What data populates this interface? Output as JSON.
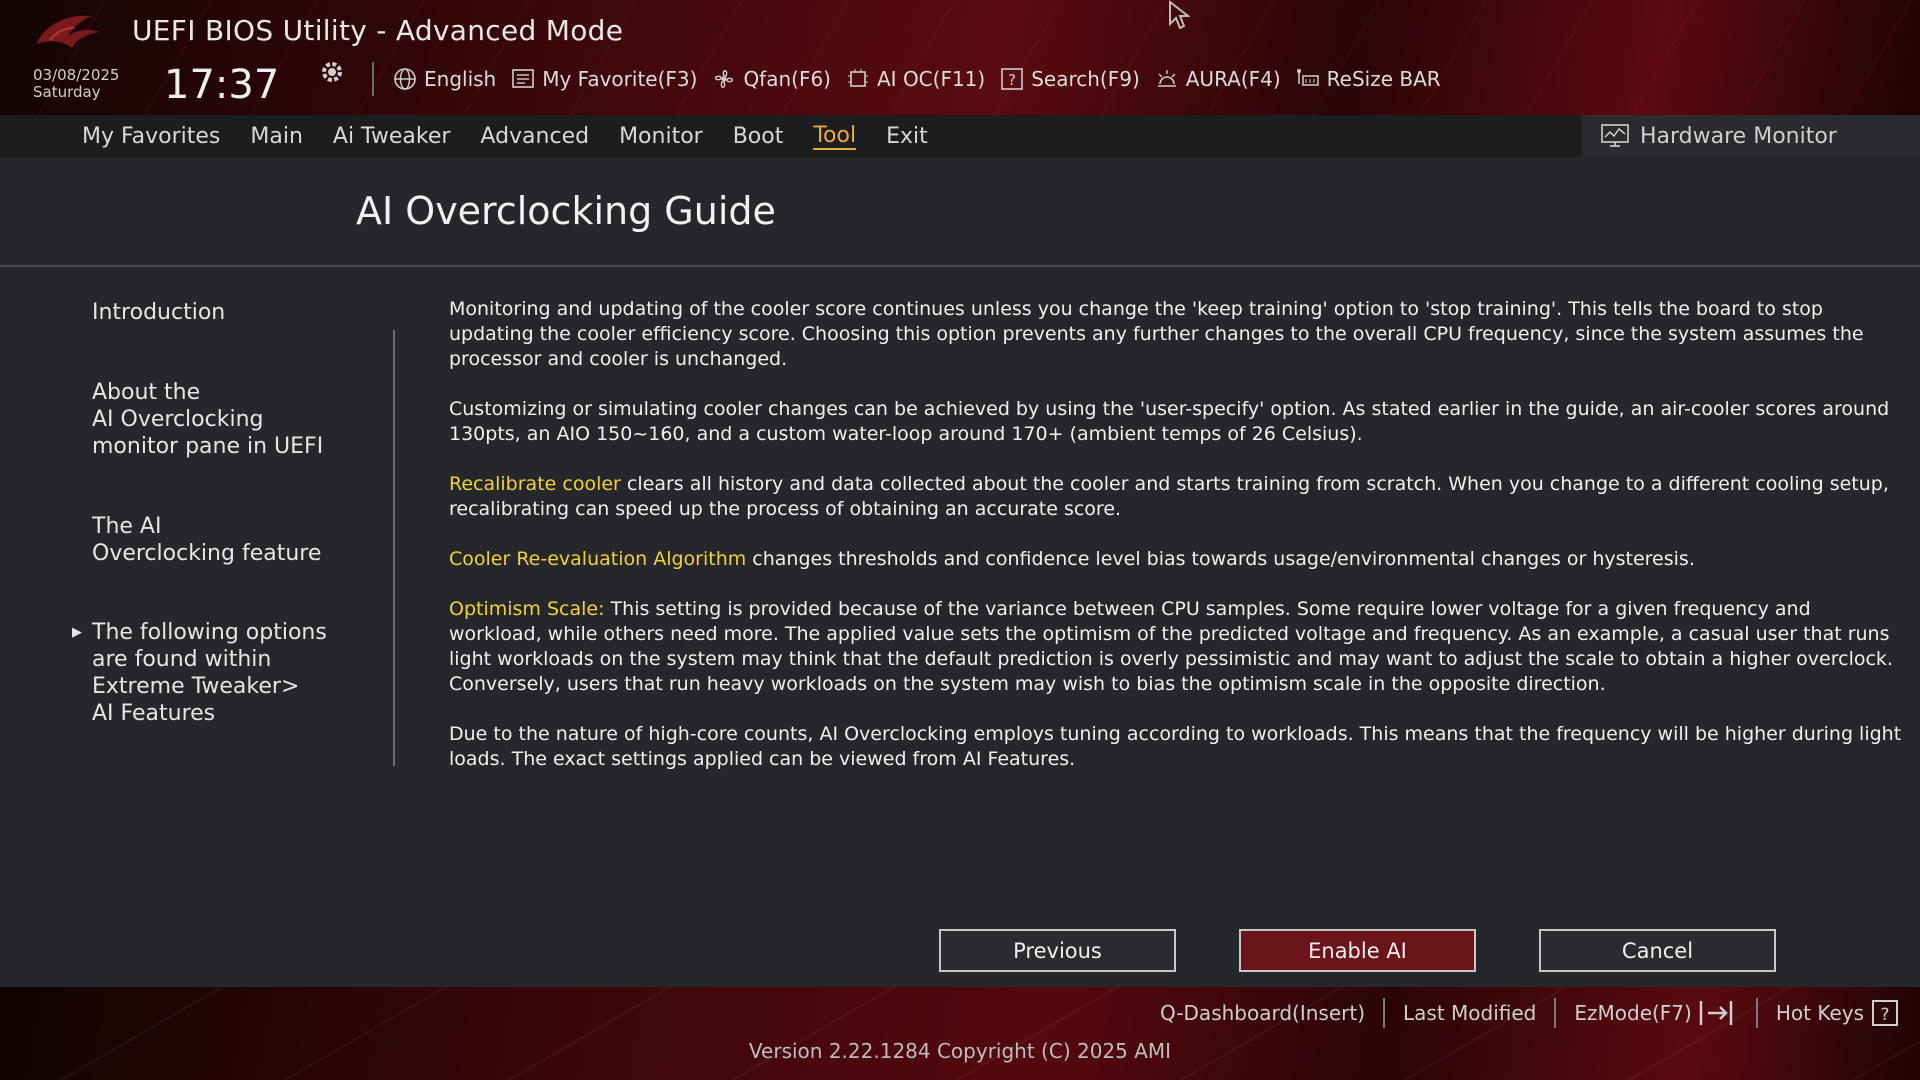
{
  "app": {
    "title": "UEFI BIOS Utility - Advanced Mode",
    "date": "03/08/2025",
    "day": "Saturday",
    "time": "17:37"
  },
  "toolbar": {
    "items": [
      {
        "label": "English",
        "icon": "globe-icon"
      },
      {
        "label": "My Favorite(F3)",
        "icon": "favorite-list-icon"
      },
      {
        "label": "Qfan(F6)",
        "icon": "fan-icon"
      },
      {
        "label": "AI OC(F11)",
        "icon": "ai-chip-icon"
      },
      {
        "label": "Search(F9)",
        "icon": "search-help-icon"
      },
      {
        "label": "AURA(F4)",
        "icon": "aura-light-icon"
      },
      {
        "label": "ReSize BAR",
        "icon": "resize-bar-icon"
      }
    ]
  },
  "menu": {
    "items": [
      "My Favorites",
      "Main",
      "Ai Tweaker",
      "Advanced",
      "Monitor",
      "Boot",
      "Tool",
      "Exit"
    ],
    "active": "Tool"
  },
  "hardware_monitor": {
    "label": "Hardware Monitor"
  },
  "guide": {
    "title": "AI Overclocking Guide",
    "sidebar": [
      {
        "line1": "Introduction"
      },
      {
        "line1": "About the",
        "line2": "AI Overclocking",
        "line3": "monitor pane in UEFI"
      },
      {
        "line1": "The AI",
        "line2": "Overclocking feature"
      },
      {
        "line1": "The following options",
        "line2": "are found within",
        "line3": "Extreme Tweaker>",
        "line4": "AI Features"
      }
    ],
    "p1": "Monitoring and updating of the cooler score continues unless you change the 'keep training' option to 'stop training'. This tells the board to stop updating the cooler efficiency score. Choosing this option prevents any further changes to the overall CPU frequency, since the system assumes the processor and cooler is unchanged.",
    "p2": "Customizing or simulating cooler changes can be achieved by using the 'user-specify' option. As stated earlier in the guide, an air-cooler scores around 130pts, an AIO 150~160, and a custom water-loop around 170+ (ambient temps of 26 Celsius).",
    "p3_hl": "Recalibrate cooler",
    "p3": " clears all history and data collected about the cooler and starts training from scratch. When you change to a different cooling setup, recalibrating can speed up the process of obtaining an accurate score.",
    "p4_hl": "Cooler Re-evaluation Algorithm",
    "p4": " changes thresholds and confidence level bias towards usage/environmental changes or hysteresis.",
    "p5_hl": "Optimism Scale:",
    "p5": " This setting is provided because of the variance between CPU samples. Some require lower voltage for a given frequency and workload, while others need more. The applied value sets the optimism of the predicted voltage and frequency. As an example, a casual user that runs light workloads on the system may think that the default prediction is overly pessimistic and may want to adjust the scale to obtain a higher overclock. Conversely, users that run heavy workloads on the system may wish to bias the optimism scale in the opposite direction.",
    "p6": "Due to the nature of high-core counts, AI Overclocking employs tuning according to workloads. This means that the frequency will be higher during light loads. The exact settings applied can be viewed from AI Features."
  },
  "buttons": {
    "previous": "Previous",
    "enable": "Enable AI",
    "cancel": "Cancel"
  },
  "footer": {
    "qdashboard": "Q-Dashboard(Insert)",
    "last_modified": "Last Modified",
    "ezmode": "EzMode(F7)",
    "hotkeys": "Hot Keys",
    "version": "Version 2.22.1284 Copyright (C) 2025 AMI"
  },
  "colors": {
    "accent_active_tab": "#e9a93f",
    "highlight_text": "#f2d23a",
    "primary_button": "#6b1419"
  }
}
